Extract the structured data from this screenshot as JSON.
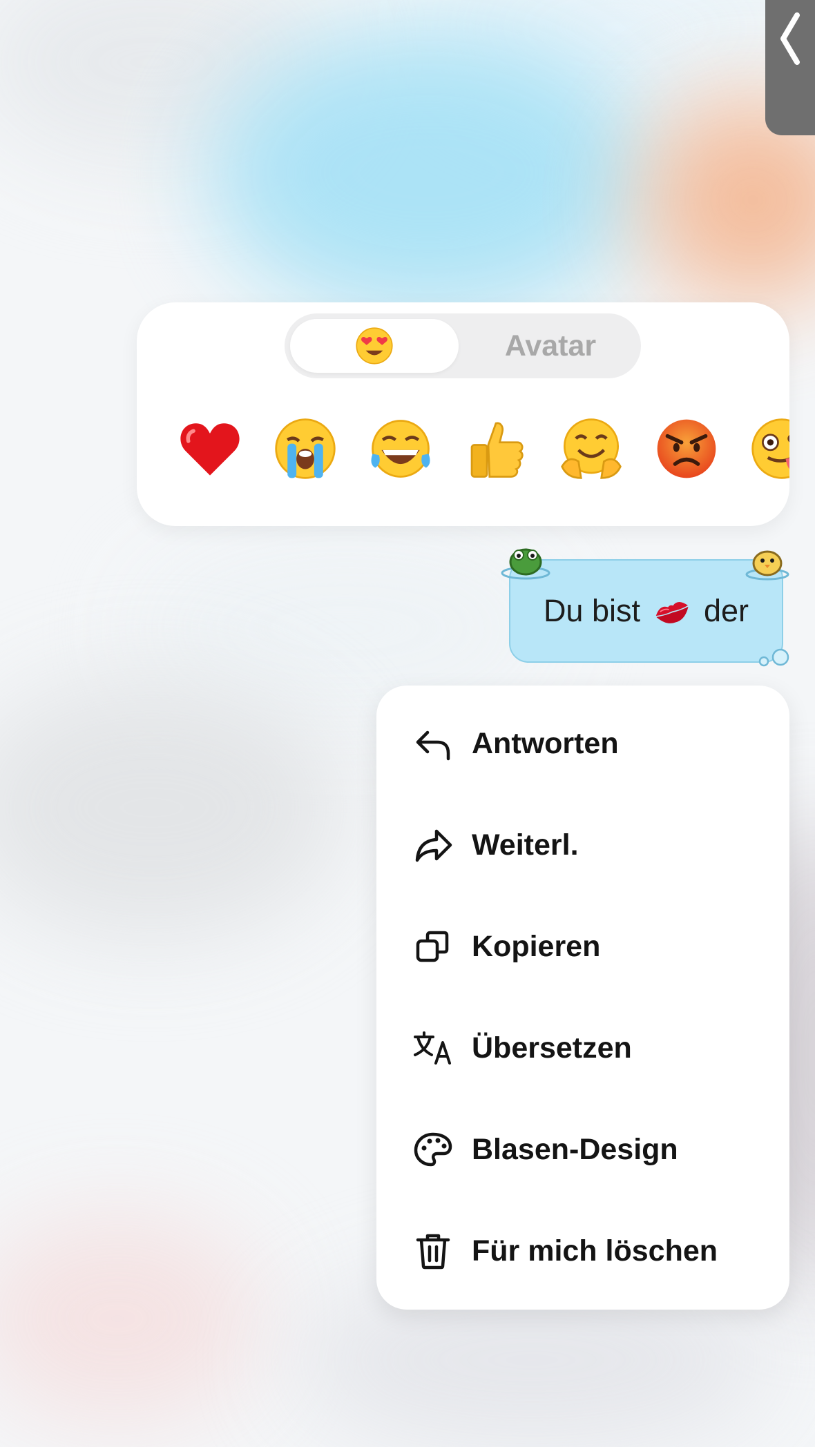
{
  "reaction_panel": {
    "tabs": [
      {
        "label": "😍",
        "icon": "heart-eyes-emoji",
        "selected": true
      },
      {
        "label": "Avatar",
        "selected": false
      }
    ],
    "emojis": [
      {
        "name": "red-heart-emoji",
        "glyph": "❤️"
      },
      {
        "name": "loudly-crying-emoji",
        "glyph": "😭"
      },
      {
        "name": "tears-of-joy-emoji",
        "glyph": "😂"
      },
      {
        "name": "thumbs-up-emoji",
        "glyph": "👍"
      },
      {
        "name": "hugging-face-emoji",
        "glyph": "🤗"
      },
      {
        "name": "angry-face-emoji",
        "glyph": "😡"
      },
      {
        "name": "zany-face-emoji",
        "glyph": "🤪"
      }
    ]
  },
  "message": {
    "text_before": "Du bist",
    "emoji": "💋",
    "text_after": "der",
    "bubble_color": "#b8e6f8"
  },
  "context_menu": {
    "items": [
      {
        "label": "Antworten",
        "icon": "reply-icon"
      },
      {
        "label": "Weiterl.",
        "icon": "forward-icon"
      },
      {
        "label": "Kopieren",
        "icon": "copy-icon"
      },
      {
        "label": "Übersetzen",
        "icon": "translate-icon"
      },
      {
        "label": "Blasen-Design",
        "icon": "palette-icon"
      },
      {
        "label": "Für mich löschen",
        "icon": "trash-icon"
      }
    ]
  }
}
